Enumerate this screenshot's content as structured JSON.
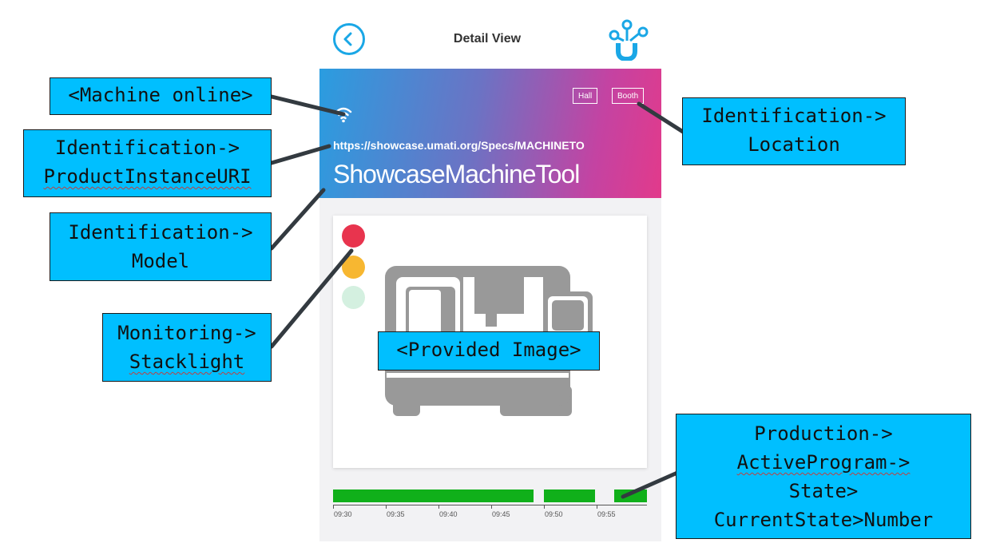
{
  "header": {
    "title": "Detail View",
    "back_icon": "back-arrow-icon",
    "logo_icon": "umati-logo-icon",
    "accent_color": "#1aa7e6"
  },
  "banner": {
    "location_badges": [
      "Hall",
      "Booth"
    ],
    "product_instance_uri": "https://showcase.umati.org/Specs/MACHINETO",
    "model": "ShowcaseMachineTool",
    "online_icon": "wifi-icon"
  },
  "stacklight": {
    "colors": [
      "#e8344e",
      "#f7b731",
      "#d4f0e0"
    ],
    "states": [
      "red-on",
      "yellow-on",
      "green-off"
    ]
  },
  "image": {
    "icon": "machine-tool-icon"
  },
  "timeline": {
    "tick_labels": [
      "09:30",
      "09:35",
      "09:40",
      "09:45",
      "09:50",
      "09:55"
    ],
    "bar_color": "#10b01a"
  },
  "annotations": {
    "machine_online": [
      "<Machine online>"
    ],
    "product_uri": [
      "Identification->",
      "ProductInstanceURI"
    ],
    "model": [
      "Identification->",
      "Model"
    ],
    "stacklight": [
      "Monitoring->",
      "Stacklight"
    ],
    "location": [
      "Identification->",
      "Location"
    ],
    "provided_image": [
      "<Provided Image>"
    ],
    "program_state": [
      "Production->",
      "ActiveProgram->",
      "State>",
      "CurrentState>Number"
    ]
  }
}
